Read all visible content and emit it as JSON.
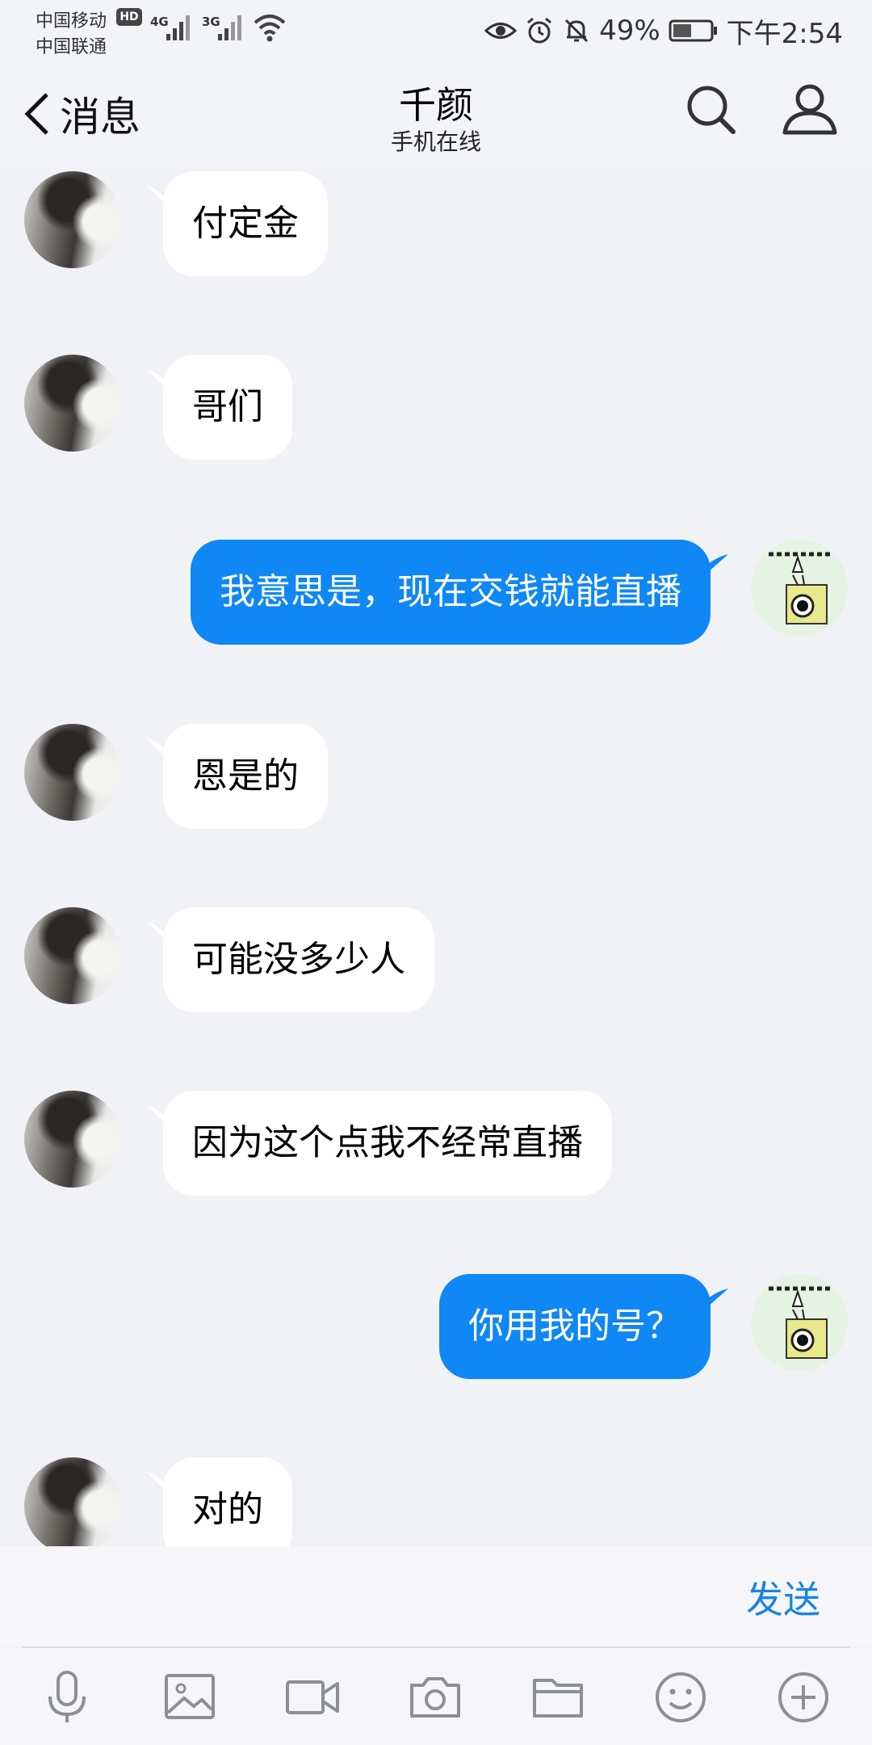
{
  "status_bar": {
    "carrier_1": "中国移动",
    "carrier_2": "中国联通",
    "hd_badge": "HD",
    "network_1": "4G",
    "network_2": "3G",
    "battery_percent": "49%",
    "time": "下午2:54",
    "icons": [
      "eye-icon",
      "alarm-icon",
      "mute-bell-icon",
      "battery-icon",
      "wifi-icon",
      "signal-icon"
    ]
  },
  "header": {
    "back_label": "消息",
    "title": "千颜",
    "subtitle": "手机在线"
  },
  "messages": [
    {
      "side": "left",
      "text": "付定金"
    },
    {
      "side": "left",
      "text": "哥们"
    },
    {
      "side": "right",
      "text": "我意思是，现在交钱就能直播"
    },
    {
      "side": "left",
      "text": "恩是的"
    },
    {
      "side": "left",
      "text": "可能没多少人"
    },
    {
      "side": "left",
      "text": "因为这个点我不经常直播"
    },
    {
      "side": "right",
      "text": "你用我的号？"
    },
    {
      "side": "left",
      "text": "对的"
    }
  ],
  "input": {
    "placeholder": "",
    "send_label": "发送"
  },
  "toolbar": [
    "microphone-icon",
    "image-icon",
    "video-icon",
    "camera-icon",
    "folder-icon",
    "emoji-icon",
    "plus-icon"
  ],
  "colors": {
    "outgoing_bubble": "#0f87f5",
    "incoming_bubble": "#ffffff",
    "background": "#f1f2f6",
    "send_text": "#1784e3"
  }
}
